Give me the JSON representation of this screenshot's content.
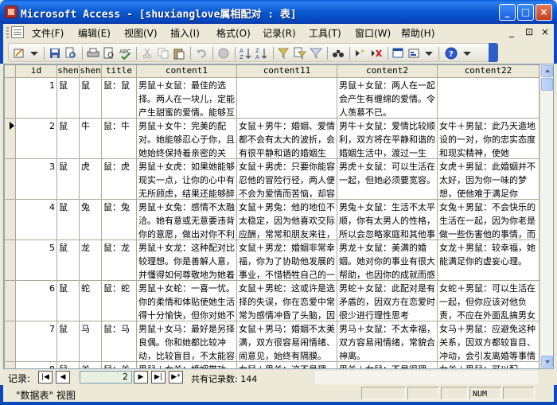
{
  "window": {
    "title": "Microsoft Access - [shuxianglove属相配对 : 表]",
    "min_symbol": "_",
    "max_symbol": "□",
    "close_symbol": "×"
  },
  "menu": {
    "items": [
      "文件(F)",
      "编辑(E)",
      "视图(V)",
      "插入(I)",
      "格式(O)",
      "记录(R)",
      "工具(T)",
      "窗口(W)",
      "帮助(H)"
    ],
    "right_controls": [
      "_",
      "⊡",
      "×"
    ]
  },
  "toolbar": {
    "buttons": [
      "view-icon",
      "save-icon",
      "search-file-icon",
      "print-icon",
      "print-preview-icon",
      "spelling-icon",
      "cut-icon",
      "copy-icon",
      "paste-icon",
      "undo-icon",
      "hyperlink-icon",
      "sort-ascending-icon",
      "sort-descending-icon",
      "filter-selection-icon",
      "filter-form-icon",
      "apply-filter-icon",
      "find-icon",
      "new-record-icon",
      "delete-record-icon",
      "database-window-icon",
      "new-object-icon",
      "help-icon"
    ]
  },
  "table": {
    "columns": [
      "id",
      "shen",
      "shen",
      "title",
      "content1",
      "content11",
      "content2",
      "content22"
    ],
    "current_row": 1,
    "rows": [
      {
        "id": "1",
        "shen1": "鼠",
        "shen2": "鼠",
        "title": "鼠：鼠",
        "content1": "男鼠＋女鼠：最佳的选择。两人在一块儿，定能产生甜蜜的爱情。能够互相理解对方的",
        "content11": "",
        "content2": "男鼠＋女鼠：两人在一起会产生有缠绵的爱情。令人羡慕不已。",
        "content22": ""
      },
      {
        "id": "2",
        "shen1": "鼠",
        "shen2": "牛",
        "title": "鼠：牛",
        "content1": "男鼠＋女牛：完美的配对。她能够忍心于你，且她始终保持着亲密的关系，使你放松警惕",
        "content11": "女鼠＋男牛：婚姻、爱情都不会有太大的波折，会有很平静和谐的婚姻生活，",
        "content2": "男牛＋女鼠：爱情比较顺利，双方将在平静和谐的婚姻生活中，渡过一生",
        "content22": "女牛＋男鼠：此乃天造地设的一对，你的忠实态度和现实精神，使她"
      },
      {
        "id": "3",
        "shen1": "鼠",
        "shen2": "虎",
        "title": "鼠：虎",
        "content1": "男鼠＋女虎：如果她能够现实一点，让你的心中有无所顾虑，结果还能够醉恶原谅你",
        "content11": "女鼠＋男虎：只要你能容忍他的冒险行径，两人便不会为爱情而苦恼，却容忍宽容为他欢来",
        "content2": "男虎＋女鼠：可以生活在一起，但她必须要宽容。",
        "content22": "女虎＋男鼠：此婚姻并不太好，因为你一味的梦想，使他难于满足你"
      },
      {
        "id": "4",
        "shen1": "鼠",
        "shen2": "兔",
        "title": "鼠：兔",
        "content1": "男鼠＋女兔：感情不太融洽。她有意或无意要违背你的意愿，做出对你不利之事，若要",
        "content11": "女鼠＋男兔：他的地位不太稳定，因为他喜欢交际应酬，常常和朋友来往，若男不学好",
        "content2": "男兔＋女鼠：生活不太平顺，你有太男人的性格，所以会忽略家庭和其他事情",
        "content22": "女兔＋男鼠：不会快乐的生活在一起，因为你老是做一些伤害他的事情，而以后"
      },
      {
        "id": "5",
        "shen1": "鼠",
        "shen2": "龙",
        "title": "鼠：龙",
        "content1": "男鼠＋女龙：这种配对比较理想。你是善解人意，并懂得如何尊敬地为她着想，她也能",
        "content11": "女鼠＋男龙：婚姻非常幸福，你为了协助他发展的事业，不惜牺牲自己的一切",
        "content2": "男龙＋女鼠：美满的婚姻。她对你的事业有很大帮助，也因你的成就而感到骄傲",
        "content22": "女龙＋男鼠：较幸福，她能满足你的虚妄心理。"
      },
      {
        "id": "6",
        "shen1": "鼠",
        "shen2": "蛇",
        "title": "鼠：蛇",
        "content1": "男鼠＋女蛇：一喜一忧。你的柔情和体贴使她生活得十分愉快，但你对她不会有过多的",
        "content11": "女鼠＋男蛇：这或许是选择的失误，你在恋爱中常常为感情冲昏了头脑，因此容易受到",
        "content2": "男蛇＋女鼠：此配对是有矛盾的，因双方在恋爱时很少进行理性思考",
        "content22": "女蛇＋男鼠：可以生活在一起，但你应该对他负责，不应在外面乱搞男女关系"
      },
      {
        "id": "7",
        "shen1": "鼠",
        "shen2": "马",
        "title": "鼠：马",
        "content1": "男鼠＋女马：最好是另择良偶。你和她都比较冲动，比较盲目，不太能容忍对方",
        "content11": "女鼠＋男马：婚姻不太美满，双方很容易闹情绪、闹意见，始终有隔膜。",
        "content2": "男马＋女鼠：不太幸福，双方容易闹情绪，常貌合神离。",
        "content22": "女马＋男鼠：应避免这种关系，因双方都较盲目、冲动，会引发离婚等事情发生"
      },
      {
        "id": "8",
        "shen1": "鼠",
        "shen2": "羊",
        "title": "鼠：羊",
        "content1": "男鼠＋女羊：婚姻带功",
        "content11": "女鼠＋男羊：这不是理",
        "content2": "男羊＋女鼠：不是很理",
        "content22": "女羊＋男鼠：可以配"
      }
    ]
  },
  "navigation": {
    "label": "记录:",
    "current": "2",
    "count_text": "共有记录数: 144",
    "first": "|◀",
    "prev": "◀",
    "next": "▶",
    "last": "▶|",
    "new": "▶*"
  },
  "status": {
    "view": "\"数据表\" 视图",
    "num": "NUM"
  }
}
